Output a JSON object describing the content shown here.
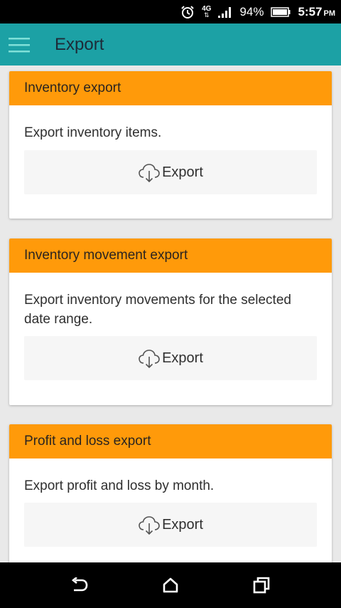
{
  "status_bar": {
    "alarm_icon": "alarm-clock-icon",
    "network_label": "4G",
    "battery": "94%",
    "time": "5:57",
    "ampm": "PM"
  },
  "app_bar": {
    "title": "Export",
    "color": "#1ca1a5"
  },
  "cards": [
    {
      "title": "Inventory export",
      "description": "Export inventory items.",
      "button_label": "Export"
    },
    {
      "title": "Inventory movement export",
      "description": "Export inventory movements for the selected date range.",
      "button_label": "Export"
    },
    {
      "title": "Profit and loss export",
      "description": "Export profit and loss by month.",
      "button_label": "Export"
    }
  ],
  "colors": {
    "card_header": "#ff9a0a",
    "background": "#e9e9e9"
  },
  "nav_bar": {
    "back_icon": "back-icon",
    "home_icon": "home-icon",
    "recents_icon": "recent-apps-icon"
  }
}
